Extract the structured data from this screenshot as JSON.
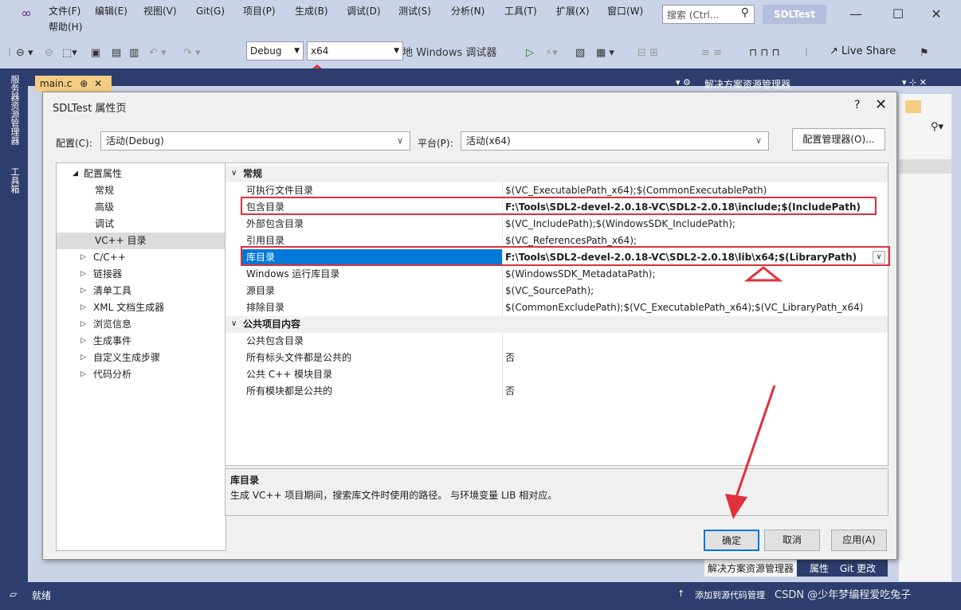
{
  "menu": {
    "file": "文件(F)",
    "edit": "编辑(E)",
    "view": "视图(V)",
    "git": "Git(G)",
    "project": "项目(P)",
    "build": "生成(B)",
    "debug": "调试(D)",
    "test": "测试(S)",
    "analyze": "分析(N)",
    "tools": "工具(T)",
    "extensions": "扩展(X)",
    "window": "窗口(W)",
    "help": "帮助(H)",
    "search_placeholder": "搜索 (Ctrl...",
    "solution_name": "SDLTest"
  },
  "toolbar": {
    "config": "Debug",
    "platform": "x64",
    "run_label": "▶ 本地 Windows 调试器",
    "live_share": "Live Share"
  },
  "side_tabs": {
    "server_explorer": "服务器资源管理器",
    "toolbox": "工具箱"
  },
  "editor": {
    "tab_label": "main.c",
    "tab_pin": "⊕",
    "tab_close": "✕",
    "solution_explorer_title": "解决方案资源管理器"
  },
  "dialog": {
    "title": "SDLTest 属性页",
    "help": "?",
    "close": "✕",
    "config_label": "配置(C):",
    "config_value": "活动(Debug)",
    "platform_label": "平台(P):",
    "platform_value": "活动(x64)",
    "config_manager": "配置管理器(O)...",
    "tree": [
      {
        "label": "配置属性",
        "prefix": "◢"
      },
      {
        "label": "常规",
        "prefix": ""
      },
      {
        "label": "高级",
        "prefix": ""
      },
      {
        "label": "调试",
        "prefix": ""
      },
      {
        "label": "VC++ 目录",
        "prefix": ""
      },
      {
        "label": "C/C++",
        "prefix": "▷"
      },
      {
        "label": "链接器",
        "prefix": "▷"
      },
      {
        "label": "清单工具",
        "prefix": "▷"
      },
      {
        "label": "XML 文档生成器",
        "prefix": "▷"
      },
      {
        "label": "浏览信息",
        "prefix": "▷"
      },
      {
        "label": "生成事件",
        "prefix": "▷"
      },
      {
        "label": "自定义生成步骤",
        "prefix": "▷"
      },
      {
        "label": "代码分析",
        "prefix": "▷"
      }
    ],
    "sections": {
      "general": "常规",
      "public": "公共项目内容"
    },
    "props": [
      {
        "key": "可执行文件目录",
        "value": "$(VC_ExecutablePath_x64);$(CommonExecutablePath)"
      },
      {
        "key": "包含目录",
        "value": "F:\\Tools\\SDL2-devel-2.0.18-VC\\SDL2-2.0.18\\include;$(IncludePath)"
      },
      {
        "key": "外部包含目录",
        "value": "$(VC_IncludePath);$(WindowsSDK_IncludePath);"
      },
      {
        "key": "引用目录",
        "value": "$(VC_ReferencesPath_x64);"
      },
      {
        "key": "库目录",
        "value": "F:\\Tools\\SDL2-devel-2.0.18-VC\\SDL2-2.0.18\\lib\\x64;$(LibraryPath)"
      },
      {
        "key": "Windows 运行库目录",
        "value": "$(WindowsSDK_MetadataPath);"
      },
      {
        "key": "源目录",
        "value": "$(VC_SourcePath);"
      },
      {
        "key": "排除目录",
        "value": "$(CommonExcludePath);$(VC_ExecutablePath_x64);$(VC_LibraryPath_x64)"
      }
    ],
    "public_props": [
      {
        "key": "公共包含目录",
        "value": ""
      },
      {
        "key": "所有标头文件都是公共的",
        "value": "否"
      },
      {
        "key": "公共 C++ 模块目录",
        "value": ""
      },
      {
        "key": "所有模块都是公共的",
        "value": "否"
      }
    ],
    "desc_title": "库目录",
    "desc_text": "生成 VC++ 项目期间，搜索库文件时使用的路径。 与环境变量 LIB 相对应。",
    "ok": "确定",
    "cancel": "取消",
    "apply": "应用(A)"
  },
  "bottom_tabs": {
    "solution_explorer": "解决方案资源管理器",
    "properties": "属性",
    "git_changes": "Git 更改"
  },
  "status": {
    "ready": "就绪",
    "add_source": "添加到源代码管理",
    "watermark": "CSDN @少年梦编程爱吃兔子"
  }
}
